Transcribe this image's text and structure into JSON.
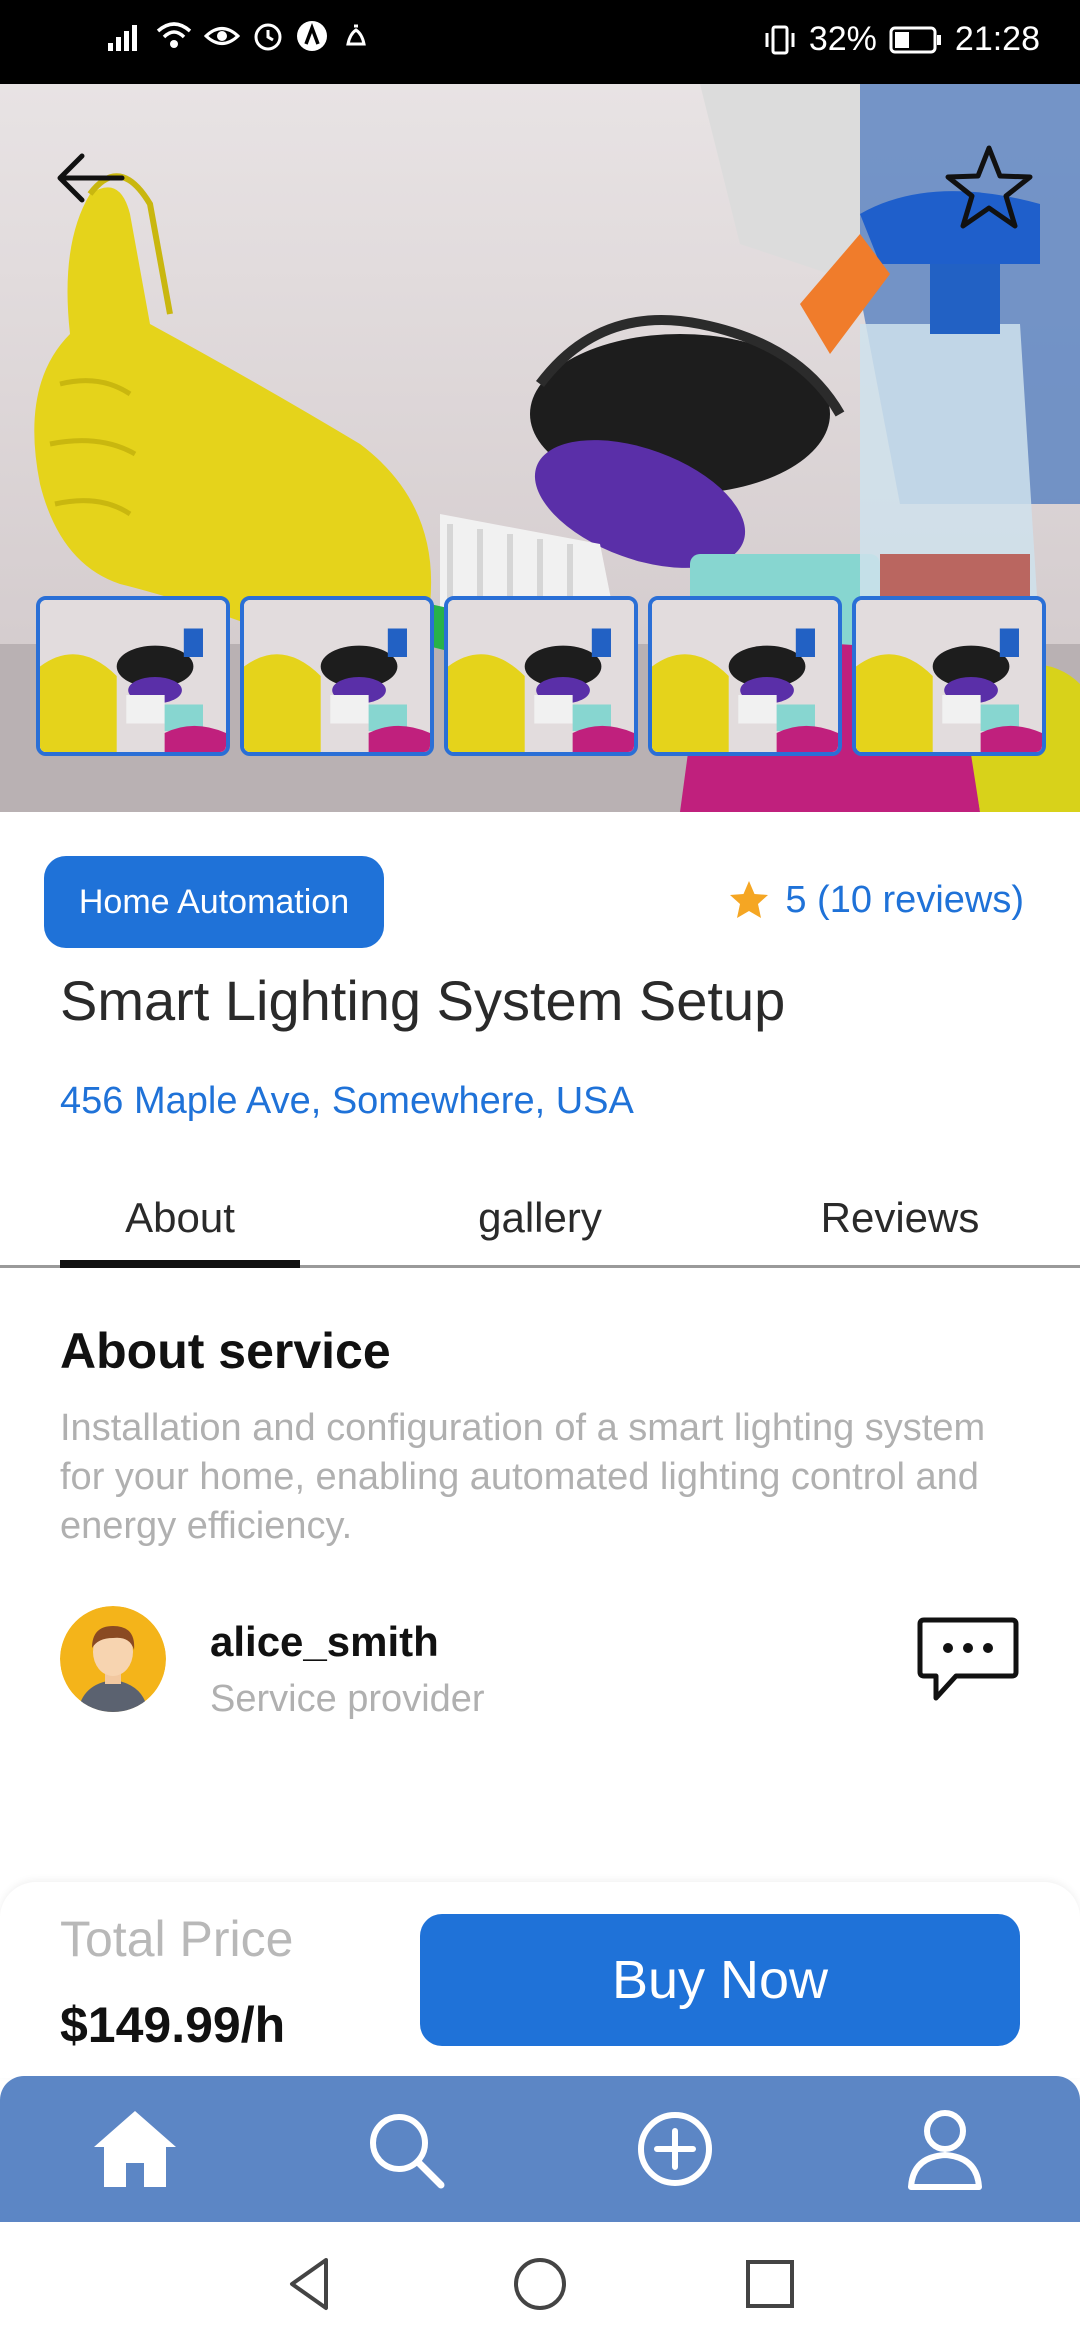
{
  "status_bar": {
    "battery_percent": "32%",
    "time": "21:28"
  },
  "service": {
    "category": "Home Automation",
    "rating_text": "5 (10 reviews)",
    "title": "Smart Lighting System Setup",
    "address": "456 Maple Ave, Somewhere, USA"
  },
  "tabs": [
    {
      "label": "About",
      "active": true
    },
    {
      "label": "gallery",
      "active": false
    },
    {
      "label": "Reviews",
      "active": false
    }
  ],
  "about": {
    "heading": "About service",
    "description": "Installation and configuration of a smart lighting system for your home, enabling automated lighting control and energy efficiency."
  },
  "provider": {
    "username": "alice_smith",
    "role": "Service provider"
  },
  "pricing": {
    "label": "Total Price",
    "value": "$149.99/h",
    "buy_label": "Buy Now"
  },
  "colors": {
    "accent": "#1f72d8",
    "nav_background": "#5c86c5",
    "star": "#f5a623"
  },
  "icons": {
    "back": "arrow-left-icon",
    "favorite": "star-outline-icon",
    "chat": "chat-bubble-icon",
    "nav": [
      "home-icon",
      "search-icon",
      "add-circle-icon",
      "profile-icon"
    ]
  }
}
